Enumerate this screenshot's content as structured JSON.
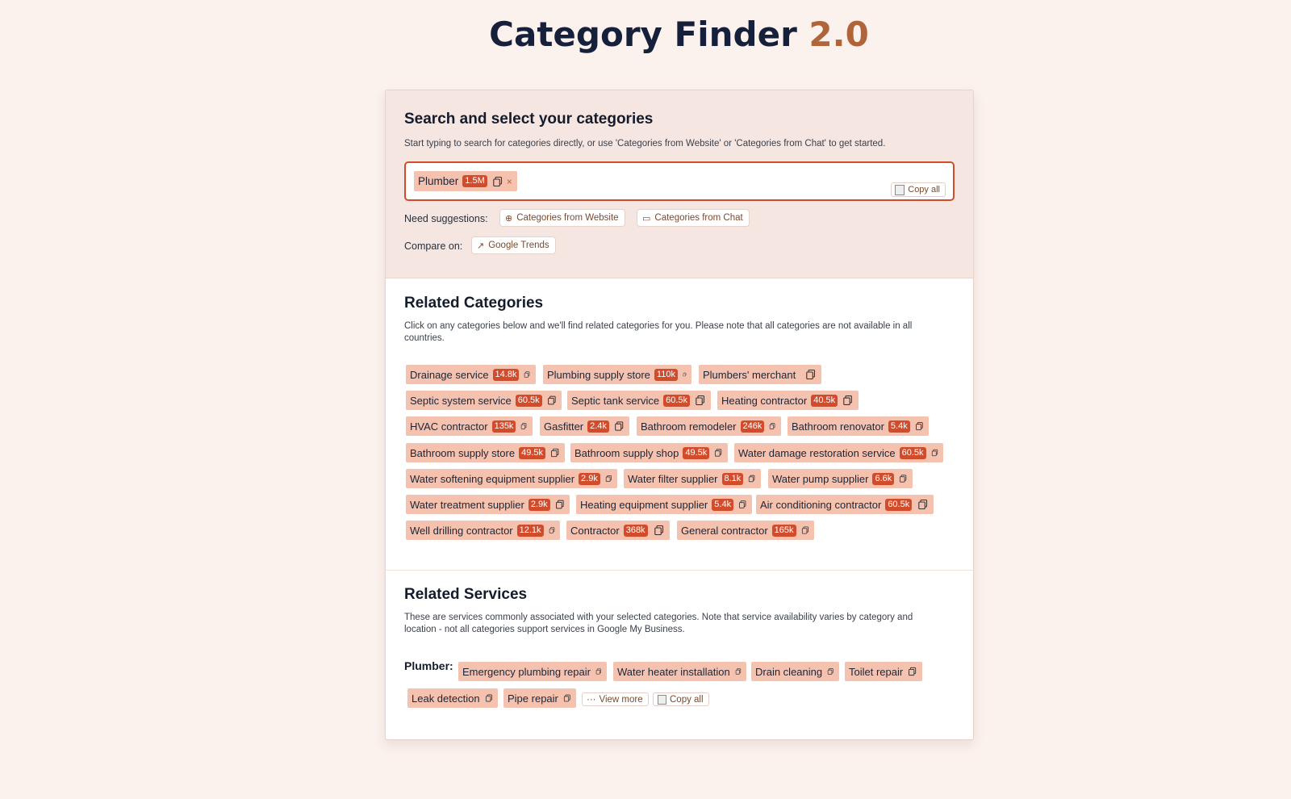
{
  "app": {
    "title": "Category Finder",
    "version": "2.0"
  },
  "search": {
    "heading": "Search and select your categories",
    "description": "Start typing to search for categories directly, or use 'Categories from Website' or 'Categories from Chat' to get started.",
    "selected": [
      {
        "label": "Plumber",
        "count": "1.5M"
      }
    ],
    "copy_all": "Copy all",
    "suggest_label": "Need suggestions:",
    "suggest_website": "Categories from Website",
    "suggest_chat": "Categories from Chat",
    "compare_label": "Compare on:",
    "compare_trends": "Google Trends"
  },
  "related": {
    "heading": "Related Categories",
    "description": "Click on any categories below and we'll find related categories for you. Please note that all categories are not available in all countries.",
    "items": [
      {
        "label": "Drainage service",
        "count": "14.8k"
      },
      {
        "label": "Plumbing supply store",
        "count": "110k"
      },
      {
        "label": "Plumbers' merchant",
        "count": ""
      },
      {
        "label": "Septic system service",
        "count": "60.5k"
      },
      {
        "label": "Septic tank service",
        "count": "60.5k"
      },
      {
        "label": "Heating contractor",
        "count": "40.5k"
      },
      {
        "label": "HVAC contractor",
        "count": "135k"
      },
      {
        "label": "Gasfitter",
        "count": "2.4k"
      },
      {
        "label": "Bathroom remodeler",
        "count": "246k"
      },
      {
        "label": "Bathroom renovator",
        "count": "5.4k"
      },
      {
        "label": "Bathroom supply store",
        "count": "49.5k"
      },
      {
        "label": "Bathroom supply shop",
        "count": "49.5k"
      },
      {
        "label": "Water damage restoration service",
        "count": "60.5k"
      },
      {
        "label": "Water softening equipment supplier",
        "count": "2.9k"
      },
      {
        "label": "Water filter supplier",
        "count": "8.1k"
      },
      {
        "label": "Water pump supplier",
        "count": "6.6k"
      },
      {
        "label": "Water treatment supplier",
        "count": "2.9k"
      },
      {
        "label": "Heating equipment supplier",
        "count": "5.4k"
      },
      {
        "label": "Air conditioning contractor",
        "count": "60.5k"
      },
      {
        "label": "Well drilling contractor",
        "count": "12.1k"
      },
      {
        "label": "Contractor",
        "count": "368k"
      },
      {
        "label": "General contractor",
        "count": "165k"
      }
    ]
  },
  "services": {
    "heading": "Related Services",
    "description": "These are services commonly associated with your selected categories. Note that service availability varies by category and location - not all categories support services in Google My Business.",
    "group_label": "Plumber:",
    "items": [
      "Emergency plumbing repair",
      "Water heater installation",
      "Drain cleaning",
      "Toilet repair",
      "Leak detection",
      "Pipe repair"
    ],
    "view_more": "View more",
    "copy_all": "Copy all"
  },
  "colors": {
    "accent": "#d24c2c",
    "chip": "#f6c2b0",
    "brand_version": "#b0643a"
  }
}
